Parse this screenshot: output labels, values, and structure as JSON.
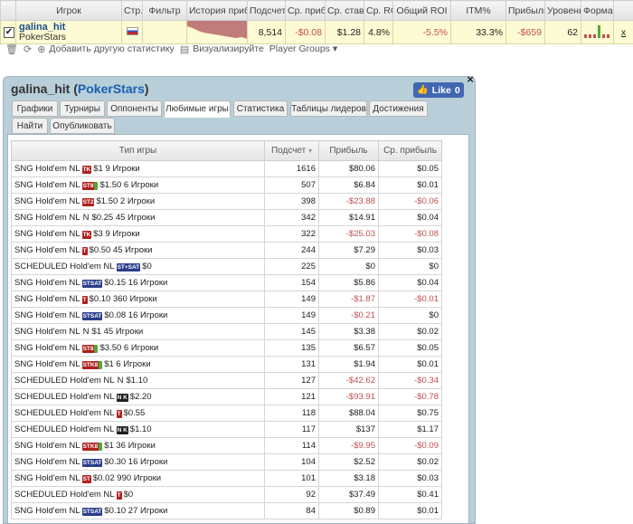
{
  "top_table": {
    "headers": [
      "Игрок",
      "Стр.",
      "Фильтр",
      "История приб",
      "Подсчет",
      "Ср. приб",
      "Ср. став",
      "Ср. ROI",
      "Общий ROI",
      "ITM%",
      "Прибыль",
      "Уровень",
      "Форма"
    ],
    "row": {
      "player": "galina_hit",
      "site": "PokerStars",
      "count": "8,514",
      "avg_profit": "-$0.08",
      "avg_stake": "$1.28",
      "avg_roi": "4.8%",
      "total_roi": "-5.5%",
      "itm": "33.3%",
      "profit": "-$659",
      "level": "62",
      "x_link": "x"
    }
  },
  "toolbar": {
    "add_stats": "Добавить другую статистику",
    "visualize": "Визуализируйте",
    "player_groups": "Player Groups ▾"
  },
  "panel": {
    "player": "galina_hit",
    "site": "PokerStars",
    "like_label": "Like",
    "like_count": "0",
    "close": "×",
    "tabs": [
      "Графики",
      "Турниры",
      "Оппоненты",
      "Любимые игры",
      "Статистика",
      "Таблицы лидеров",
      "Достижения",
      "Найти",
      "Опубликовать"
    ]
  },
  "games_table": {
    "headers": [
      "Тип игры",
      "Подсчет",
      "Прибыль",
      "Ср. прибыль"
    ],
    "rows": [
      {
        "game": "SNG Hold'em NL",
        "badge": "TK",
        "badge_color": "red",
        "desc": "$1 9 Игроки",
        "count": "1616",
        "profit": "$80.06",
        "avg": "$0.05",
        "neg": false
      },
      {
        "game": "SNG Hold'em NL",
        "badge": "ST8",
        "badge_color": "green",
        "desc": "$1.50 6 Игроки",
        "count": "507",
        "profit": "$6.84",
        "avg": "$0.01",
        "neg": false
      },
      {
        "game": "SNG Hold'em NL",
        "badge": "ST2",
        "badge_color": "red",
        "desc": "$1.50 2 Игроки",
        "count": "398",
        "profit": "-$23.88",
        "avg": "-$0.06",
        "neg": true
      },
      {
        "game": "SNG Hold'em NL",
        "badge": "N",
        "badge_color": "",
        "desc": "$0.25 45 Игроки",
        "count": "342",
        "profit": "$14.91",
        "avg": "$0.04",
        "neg": false
      },
      {
        "game": "SNG Hold'em NL",
        "badge": "TK",
        "badge_color": "red",
        "desc": "$3 9 Игроки",
        "count": "322",
        "profit": "-$25.03",
        "avg": "-$0.08",
        "neg": true
      },
      {
        "game": "SNG Hold'em NL",
        "badge": "T",
        "badge_color": "red",
        "desc": "$0.50 45 Игроки",
        "count": "244",
        "profit": "$7.29",
        "avg": "$0.03",
        "neg": false
      },
      {
        "game": "SCHEDULED Hold'em NL",
        "badge": "ST+SAT",
        "badge_color": "blue",
        "desc": "$0",
        "count": "225",
        "profit": "$0",
        "avg": "$0",
        "neg": false
      },
      {
        "game": "SNG Hold'em NL",
        "badge": "STSAT",
        "badge_color": "blue",
        "desc": "$0.15 16 Игроки",
        "count": "154",
        "profit": "$5.86",
        "avg": "$0.04",
        "neg": false
      },
      {
        "game": "SNG Hold'em NL",
        "badge": "T",
        "badge_color": "red",
        "desc": "$0.10 360 Игроки",
        "count": "149",
        "profit": "-$1.87",
        "avg": "-$0.01",
        "neg": true
      },
      {
        "game": "SNG Hold'em NL",
        "badge": "STSAT",
        "badge_color": "blue",
        "desc": "$0.08 16 Игроки",
        "count": "149",
        "profit": "-$0.21",
        "avg": "$0",
        "neg": true
      },
      {
        "game": "SNG Hold'em NL",
        "badge": "N",
        "badge_color": "",
        "desc": "$1 45 Игроки",
        "count": "145",
        "profit": "$3.38",
        "avg": "$0.02",
        "neg": false
      },
      {
        "game": "SNG Hold'em NL",
        "badge": "ST8",
        "badge_color": "green",
        "desc": "$3.50 6 Игроки",
        "count": "135",
        "profit": "$6.57",
        "avg": "$0.05",
        "neg": false
      },
      {
        "game": "SNG Hold'em NL",
        "badge": "STK8",
        "badge_color": "green",
        "desc": "$1 6 Игроки",
        "count": "131",
        "profit": "$1.94",
        "avg": "$0.01",
        "neg": false
      },
      {
        "game": "SCHEDULED Hold'em NL",
        "badge": "N",
        "badge_color": "",
        "desc": "$1.10",
        "count": "127",
        "profit": "-$42.62",
        "avg": "-$0.34",
        "neg": true
      },
      {
        "game": "SCHEDULED Hold'em NL",
        "badge": "N K",
        "badge_color": "black",
        "desc": "$2.20",
        "count": "121",
        "profit": "-$93.91",
        "avg": "-$0.78",
        "neg": true
      },
      {
        "game": "SCHEDULED Hold'em NL",
        "badge": "T",
        "badge_color": "red",
        "desc": "$0.55",
        "count": "118",
        "profit": "$88.04",
        "avg": "$0.75",
        "neg": false
      },
      {
        "game": "SCHEDULED Hold'em NL",
        "badge": "N K",
        "badge_color": "black",
        "desc": "$1.10",
        "count": "117",
        "profit": "$137",
        "avg": "$1.17",
        "neg": false
      },
      {
        "game": "SNG Hold'em NL",
        "badge": "STK8",
        "badge_color": "green",
        "desc": "$1 36 Игроки",
        "count": "114",
        "profit": "-$9.95",
        "avg": "-$0.09",
        "neg": true
      },
      {
        "game": "SNG Hold'em NL",
        "badge": "STSAT",
        "badge_color": "blue",
        "desc": "$0.30 16 Игроки",
        "count": "104",
        "profit": "$2.52",
        "avg": "$0.02",
        "neg": false
      },
      {
        "game": "SNG Hold'em NL",
        "badge": "ST",
        "badge_color": "red",
        "desc": "$0.02 990 Игроки",
        "count": "101",
        "profit": "$3.18",
        "avg": "$0.03",
        "neg": false
      },
      {
        "game": "SCHEDULED Hold'em NL",
        "badge": "T",
        "badge_color": "red",
        "desc": "$0",
        "count": "92",
        "profit": "$37.49",
        "avg": "$0.41",
        "neg": false
      },
      {
        "game": "SNG Hold'em NL",
        "badge": "STSAT",
        "badge_color": "blue",
        "desc": "$0.10 27 Игроки",
        "count": "84",
        "profit": "$0.89",
        "avg": "$0.01",
        "neg": false
      }
    ]
  },
  "colors": {
    "panel_bg": "#b8cfd9",
    "top_row_bg": "#fdfbd3",
    "negative": "#c05050",
    "link": "#1a5fb4",
    "like_btn": "#4267b2"
  }
}
